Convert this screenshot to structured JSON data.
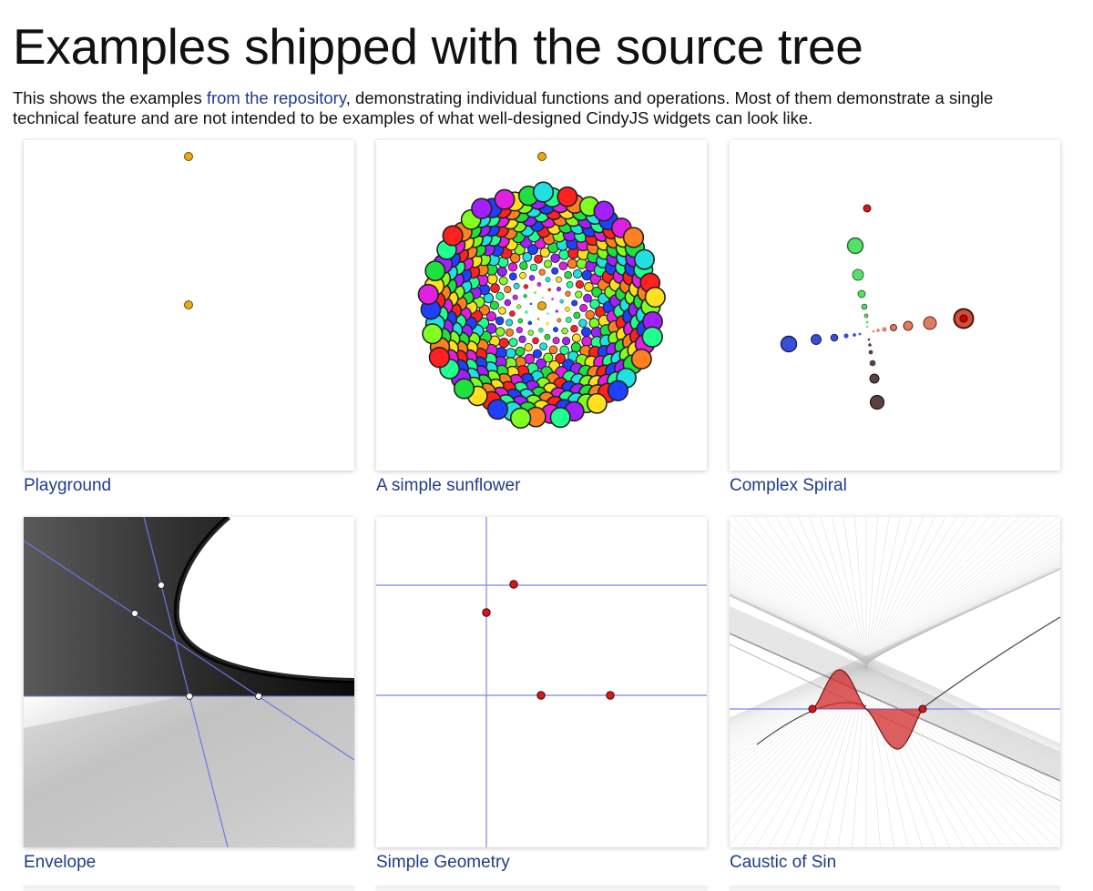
{
  "page": {
    "title": "Examples shipped with the source tree",
    "intro": {
      "before": "This shows the examples ",
      "link": "from the repository",
      "line1_after": ", demonstrating individual functions and operations. Most of them demonstrate a single",
      "line2": "technical feature and are not intended to be examples of what well-designed CindyJS widgets can look like."
    }
  },
  "examples": [
    {
      "label": "Playground"
    },
    {
      "label": "A simple sunflower"
    },
    {
      "label": "Complex Spiral"
    },
    {
      "label": "Envelope"
    },
    {
      "label": "Simple Geometry"
    },
    {
      "label": "Caustic of Sin"
    }
  ],
  "colors": {
    "link": "#1f3c88",
    "point_orange": "#e8a81a",
    "point_red": "#d11a1a",
    "line_blue": "#6b78e6"
  }
}
